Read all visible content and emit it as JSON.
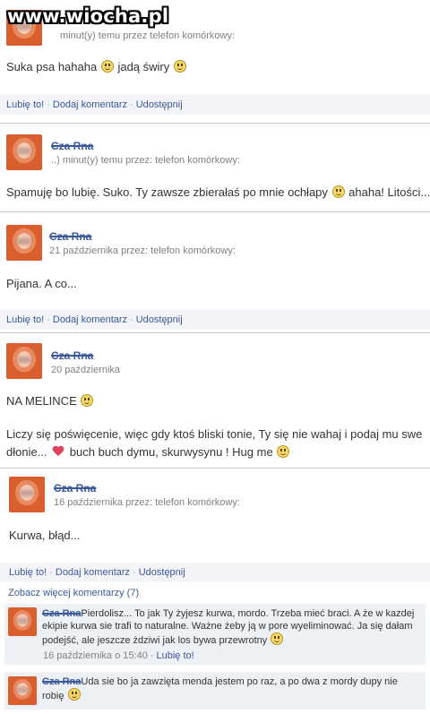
{
  "watermark": "www.wiocha.pl",
  "actions": {
    "like": "Lubię to!",
    "comment": "Dodaj komentarz",
    "share": "Udostępnij",
    "sep": "·"
  },
  "posts": [
    {
      "meta": "minut(y) temu przez telefon komórkowy:",
      "message": "Suka psa hahaha",
      "message2": "jadą świry"
    },
    {
      "name": "Cza Rna",
      "meta": "minut(y) temu przez: telefon komórkowy:",
      "message": "Spamuję bo lubię. Suko. Ty zawsze zbierałaś po mnie ochłapy",
      "message2": "ahaha! Litości..."
    },
    {
      "name": "Cza Rna",
      "meta": "21 października przez: telefon komórkowy:",
      "message": "Pijana. A co..."
    },
    {
      "name": "Cza Rna",
      "meta": "20 października",
      "message": "NA MELINCE",
      "message2": "Liczy się poświęcenie, więc gdy ktoś bliski tonie, Ty się nie wahaj i podaj mu swe dłonie...",
      "message3": "buch buch dymu, skurwysynu ! Hug me"
    },
    {
      "name": "Cza Rna",
      "meta": "16 października przez: telefon komórkowy:",
      "message": "Kurwa, błąd..."
    }
  ],
  "more_comments": "Zobacz więcej komentarzy (7)",
  "comments": [
    {
      "name": "Cza Rna",
      "text": "Pierdolisz... To jak Ty żyjesz kurwa, mordo. Trzeba mieć braci. A że w kazdej ekipie kurwa sie trafi to naturalne. Ważne żeby ją w pore wyeliminować. Ja się dałam podejść, ale jeszcze żdziwi jak los bywa przewrotny",
      "time": "16 października o 15:40",
      "like": "Lubię to!"
    },
    {
      "name": "Cza Rna",
      "text": "Uda sie bo ja zawzięta menda jestem po raz, a po dwa z mordy dupy nie robię"
    }
  ]
}
